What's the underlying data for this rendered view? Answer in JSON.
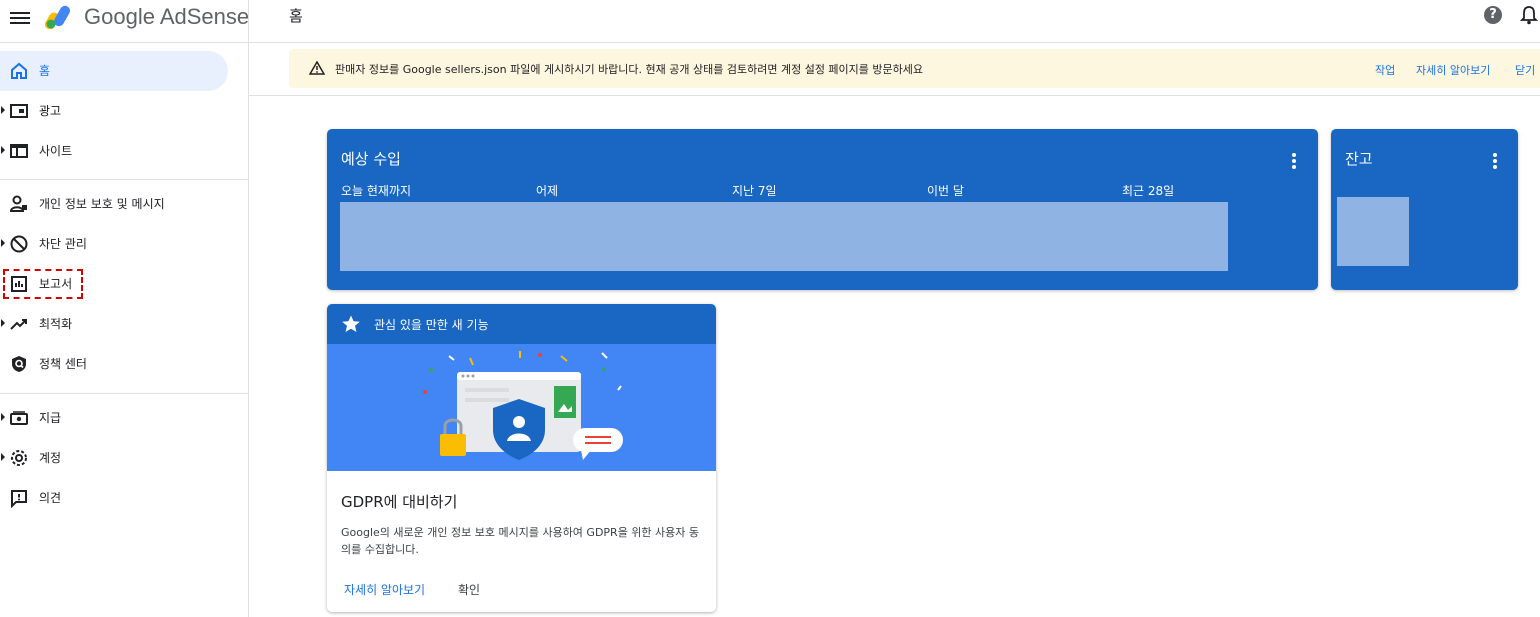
{
  "app": {
    "brand": "Google AdSense",
    "page_title": "홈"
  },
  "sidebar": {
    "items": [
      {
        "label": "홈",
        "icon": "home-icon",
        "active": true
      },
      {
        "label": "광고",
        "icon": "ads-icon"
      },
      {
        "label": "사이트",
        "icon": "sites-icon"
      },
      {
        "label": "개인 정보 보호 및 메시지",
        "icon": "privacy-icon"
      },
      {
        "label": "차단 관리",
        "icon": "block-icon"
      },
      {
        "label": "보고서",
        "icon": "reports-icon",
        "highlighted": true
      },
      {
        "label": "최적화",
        "icon": "trending-icon"
      },
      {
        "label": "정책 센터",
        "icon": "policy-icon"
      },
      {
        "label": "지급",
        "icon": "payments-icon"
      },
      {
        "label": "계정",
        "icon": "gear-icon"
      },
      {
        "label": "의견",
        "icon": "feedback-icon"
      }
    ]
  },
  "banner": {
    "text": "판매자 정보를 Google sellers.json 파일에 게시하시기 바랍니다. 현재 공개 상태를 검토하려면 계정 설정 페이지를 방문하세요",
    "actions": [
      "작업",
      "자세히 알아보기",
      "닫기"
    ]
  },
  "earnings": {
    "title": "예상 수입",
    "columns": [
      "오늘 현재까지",
      "어제",
      "지난 7일",
      "이번 달",
      "최근 28일"
    ]
  },
  "balance": {
    "title": "잔고"
  },
  "feature": {
    "header": "관심 있을 만한 새 기능",
    "title": "GDPR에 대비하기",
    "body": "Google의 새로운 개인 정보 보호 메시지를 사용하여 GDPR을 위한 사용자 동의를 수집합니다.",
    "primary_action": "자세히 알아보기",
    "secondary_action": "확인"
  },
  "colors": {
    "primary_blue": "#1967c2",
    "link_blue": "#1a73e8",
    "banner_bg": "#fef7e0",
    "highlight_red": "#d50000"
  }
}
